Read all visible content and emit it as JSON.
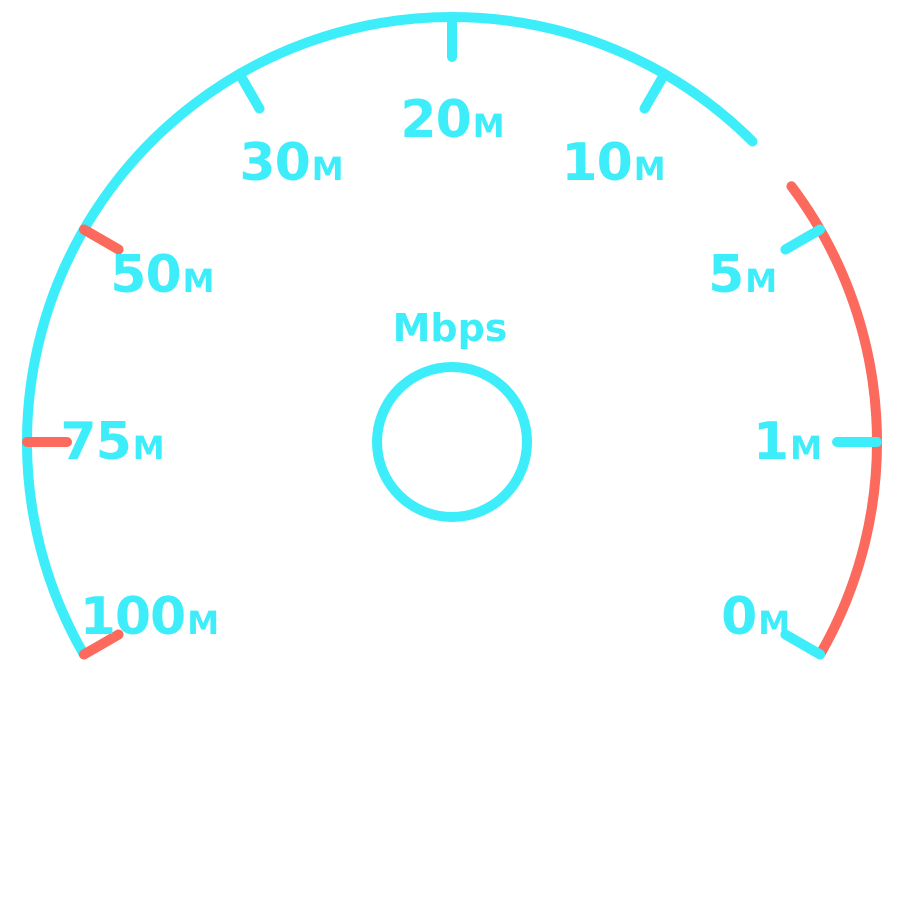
{
  "gauge": {
    "unit_label": "Mbps",
    "colors": {
      "normal": "#3DEEFA",
      "danger": "#FB6A5C"
    },
    "scale_labels": [
      {
        "number": "0",
        "unit": "M",
        "zone": "normal"
      },
      {
        "number": "1",
        "unit": "M",
        "zone": "normal"
      },
      {
        "number": "5",
        "unit": "M",
        "zone": "normal"
      },
      {
        "number": "10",
        "unit": "M",
        "zone": "normal"
      },
      {
        "number": "20",
        "unit": "M",
        "zone": "normal"
      },
      {
        "number": "30",
        "unit": "M",
        "zone": "normal"
      },
      {
        "number": "50",
        "unit": "M",
        "zone": "danger"
      },
      {
        "number": "75",
        "unit": "M",
        "zone": "danger"
      },
      {
        "number": "100",
        "unit": "M",
        "zone": "danger"
      }
    ]
  }
}
